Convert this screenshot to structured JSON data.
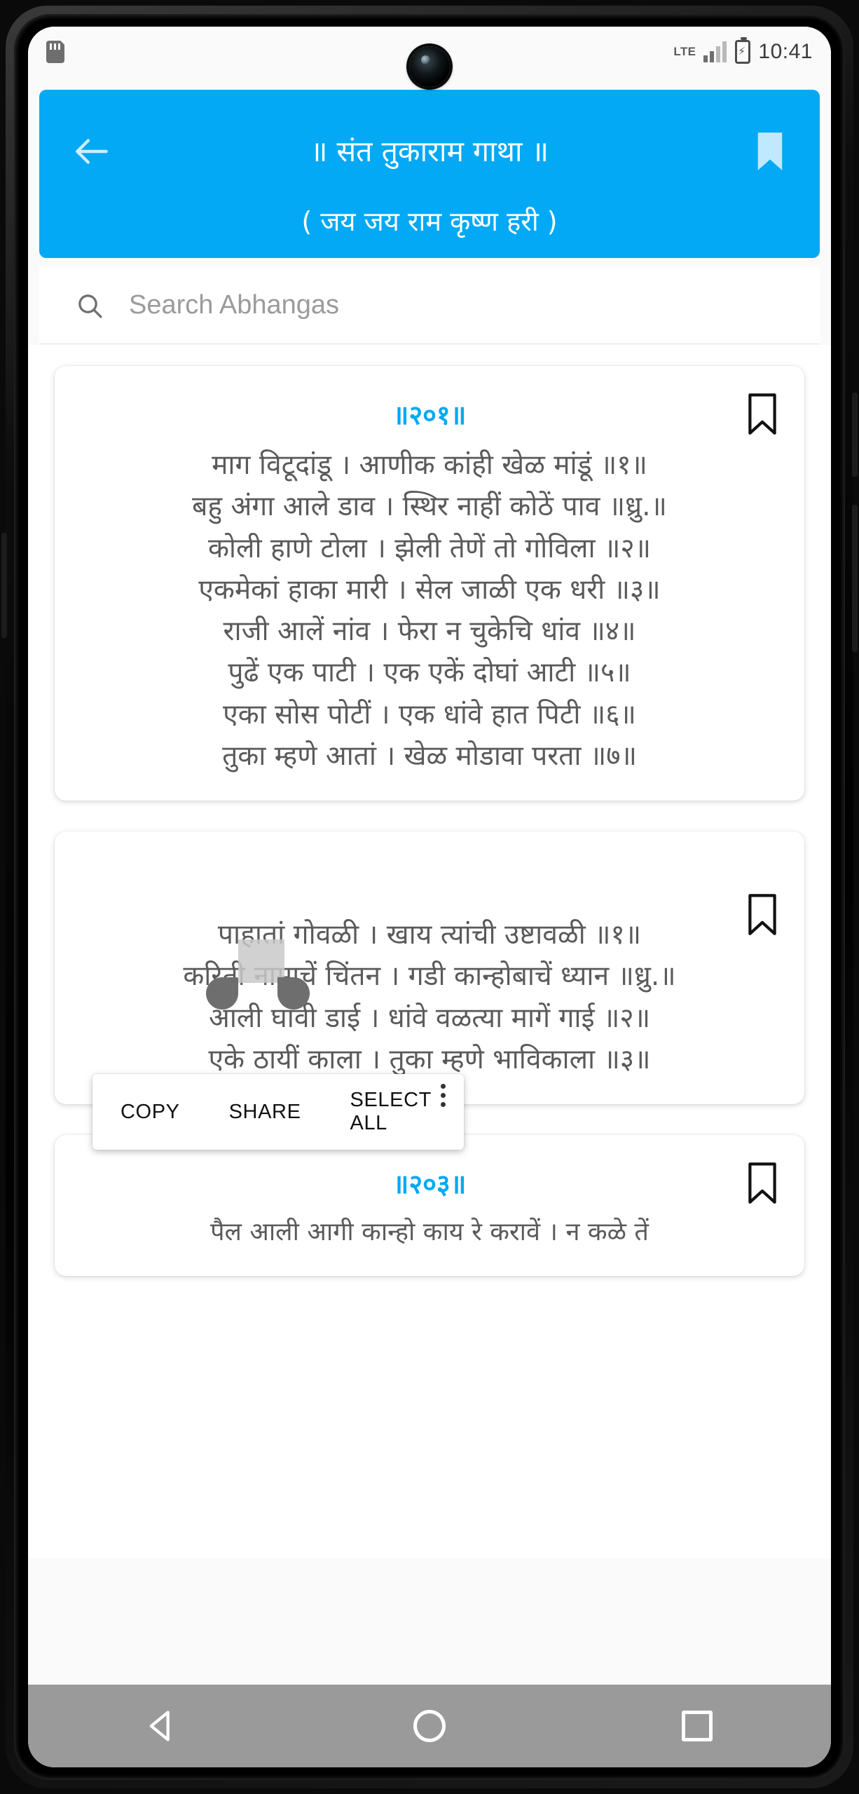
{
  "statusbar": {
    "sd_icon": "sd-card-icon",
    "network_label": "LTE",
    "signal_icon": "signal-bars-icon",
    "battery_icon": "battery-charging-icon",
    "clock": "10:41"
  },
  "appbar": {
    "back_icon": "back-arrow-icon",
    "title": "॥ संत तुकाराम गाथा ॥",
    "subtitle": "( जय जय राम कृष्ण हरी )",
    "bookmark_icon": "bookmark-icon",
    "background_color": "#03a9f4"
  },
  "search": {
    "icon": "search-icon",
    "placeholder": "Search Abhangas",
    "value": ""
  },
  "context_menu": {
    "copy_label": "COPY",
    "share_label": "SHARE",
    "select_all_label": "SELECT ALL",
    "more_icon": "overflow-menu-icon"
  },
  "accent_color": "#03a9f4",
  "cards": [
    {
      "number": "॥२०१॥",
      "bookmark_icon": "bookmark-outline-icon",
      "lines": [
        "माग विटूदांडू । आणीक कांही खेळ मांडूं ॥१॥",
        "बहु अंगा आले डाव । स्थिर नाहीं कोठें पाव ॥ध्रु.॥",
        "कोली हाणे टोला । झेली तेणें तो गोविला ॥२॥",
        "एकमेकां हाका मारी । सेल जाळी एक धरी ॥३॥",
        "राजी आलें नांव । फेरा न चुकेचि धांव ॥४॥",
        "पुढें एक पाटी । एक एकें दोघां आटी ॥५॥",
        "एका सोस पोटीं । एक धांवे हात पिटी ॥६॥",
        "तुका म्हणे आतां । खेळ मोडावा परता ॥७॥"
      ]
    },
    {
      "number": "",
      "bookmark_icon": "bookmark-outline-icon",
      "lines": [
        "पाहातां गोवळी । खाय त्यांची उष्टावळी ॥१॥",
        "करिती नामाचें चिंतन । गडी कान्होबाचें ध्यान ॥ध्रु.॥",
        "आली घावी डाई । धांवे वळत्या मागें गाई ॥२॥",
        "एके ठायीं काला । तुका म्हणे भाविकाला ॥३॥"
      ]
    },
    {
      "number": "॥२०३॥",
      "bookmark_icon": "bookmark-outline-icon",
      "lines": [
        "पैल आली आगी कान्हो काय रे करावें । न कळे तें"
      ]
    }
  ],
  "navbar": {
    "back_label": "back-button",
    "home_label": "home-button",
    "recents_label": "recents-button"
  }
}
